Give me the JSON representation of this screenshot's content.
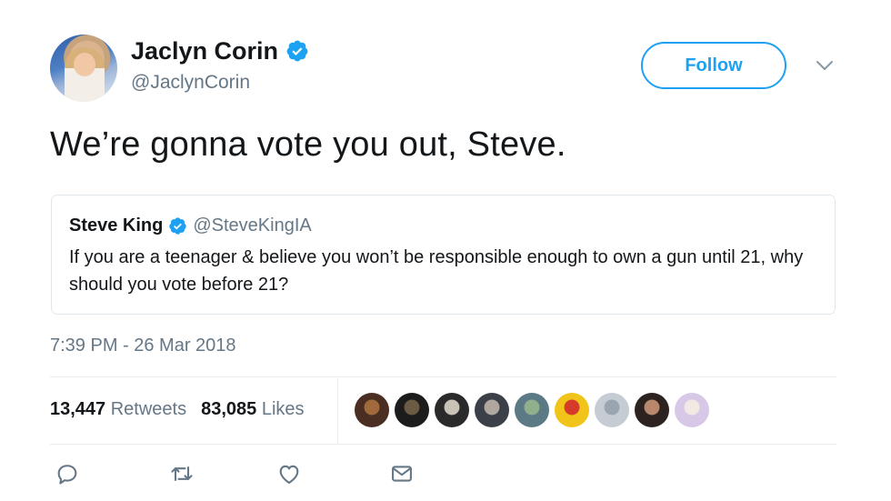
{
  "author": {
    "display_name": "Jaclyn Corin",
    "handle": "@JaclynCorin",
    "verified": true
  },
  "follow_button": {
    "label": "Follow"
  },
  "tweet": {
    "text": "We’re gonna vote you out, Steve.",
    "timestamp": "7:39 PM - 26 Mar 2018"
  },
  "quoted_tweet": {
    "display_name": "Steve King",
    "handle": "@SteveKingIA",
    "verified": true,
    "text": "If you are a teenager & believe you won’t be responsible enough to own a gun until 21, why should you vote before 21?"
  },
  "stats": {
    "retweets_count": "13,447",
    "retweets_label": "Retweets",
    "likes_count": "83,085",
    "likes_label": "Likes"
  },
  "liker_avatars": [
    {
      "colors": [
        "#4a2e22",
        "#a06a3c"
      ]
    },
    {
      "colors": [
        "#1c1c1c",
        "#6b5a44"
      ]
    },
    {
      "colors": [
        "#2a2a2a",
        "#c9c2b6"
      ]
    },
    {
      "colors": [
        "#3b3f48",
        "#b0a8a0"
      ]
    },
    {
      "colors": [
        "#5b7a86",
        "#8fb08a"
      ]
    },
    {
      "colors": [
        "#f0c419",
        "#d63b2a"
      ]
    },
    {
      "colors": [
        "#c5ccd4",
        "#9aa5b1"
      ]
    },
    {
      "colors": [
        "#2c2320",
        "#b9876b"
      ]
    },
    {
      "colors": [
        "#d8c8e8",
        "#f2e9e4"
      ]
    }
  ],
  "colors": {
    "accent": "#1da1f2",
    "secondary_text": "#657786",
    "primary_text": "#14171a",
    "border": "#e1e8ed"
  },
  "icons": {
    "reply": "reply-icon",
    "retweet": "retweet-icon",
    "like": "heart-icon",
    "dm": "envelope-icon",
    "verified": "verified-badge-icon",
    "menu": "chevron-down-icon"
  }
}
